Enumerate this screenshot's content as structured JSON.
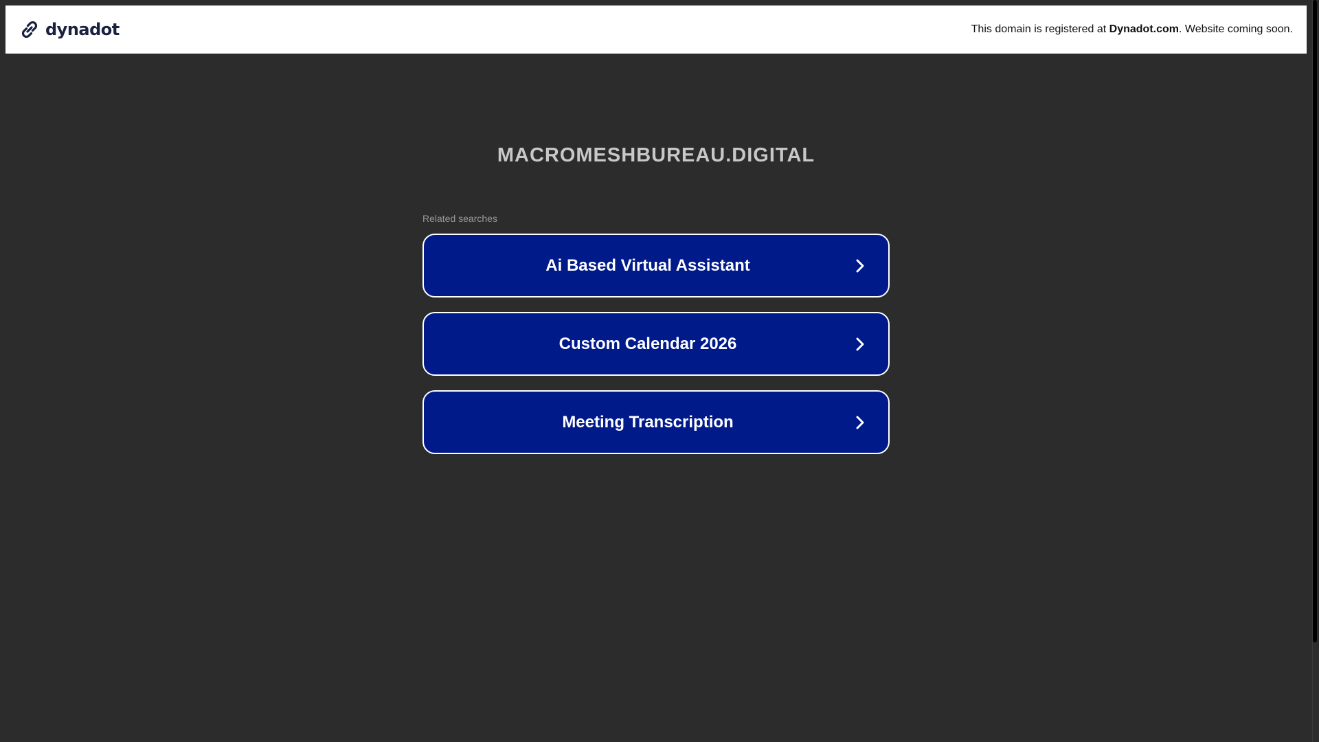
{
  "header": {
    "brand_name": "dynadot",
    "brand_icon": "link-chain-icon",
    "notice_prefix": "This domain is registered at ",
    "notice_link": "Dynadot.com",
    "notice_suffix": ". Website coming soon."
  },
  "main": {
    "domain": "MACROMESHBUREAU.DIGITAL",
    "related_label": "Related searches",
    "searches": [
      {
        "label": "Ai Based Virtual Assistant",
        "icon": "chevron-right-icon"
      },
      {
        "label": "Custom Calendar 2026",
        "icon": "chevron-right-icon"
      },
      {
        "label": "Meeting Transcription",
        "icon": "chevron-right-icon"
      }
    ]
  },
  "colors": {
    "background": "#2c2c2c",
    "header_bg": "#ffffff",
    "button_bg": "#011a8a",
    "button_border": "#ffffff",
    "title_text": "#c8c8c8",
    "brand_text": "#1a2140"
  }
}
